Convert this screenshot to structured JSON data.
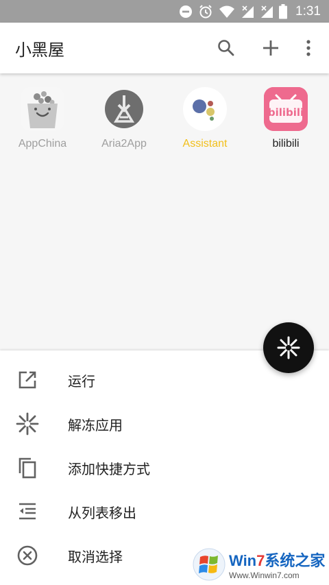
{
  "status_bar": {
    "time": "1:31",
    "icons": [
      "do-not-disturb-icon",
      "alarm-icon",
      "wifi-icon",
      "signal-icon",
      "signal-icon",
      "battery-icon"
    ]
  },
  "app_bar": {
    "title": "小黑屋",
    "actions": [
      "search-icon",
      "add-icon",
      "more-vert-icon"
    ]
  },
  "apps": [
    {
      "label": "AppChina",
      "label_color": "#9e9e9e",
      "icon": "appchina-icon"
    },
    {
      "label": "Aria2App",
      "label_color": "#9e9e9e",
      "icon": "aria2app-icon"
    },
    {
      "label": "Assistant",
      "label_color": "#f2bf1a",
      "icon": "assistant-icon"
    },
    {
      "label": "bilibili",
      "label_color": "#212121",
      "icon": "bilibili-icon",
      "icon_text": "bilibili"
    }
  ],
  "fab": {
    "icon": "freeze-icon"
  },
  "bottom_sheet": {
    "items": [
      {
        "label": "运行",
        "icon": "open-in-new-icon"
      },
      {
        "label": "解冻应用",
        "icon": "unfreeze-icon"
      },
      {
        "label": "添加快捷方式",
        "icon": "copy-shortcut-icon"
      },
      {
        "label": "从列表移出",
        "icon": "remove-from-list-icon"
      },
      {
        "label": "取消选择",
        "icon": "cancel-icon"
      }
    ]
  },
  "watermark": {
    "brand_prefix": "Win",
    "brand_seven": "7",
    "brand_suffix": "系统之家",
    "url": "Www.Winwin7.com"
  }
}
